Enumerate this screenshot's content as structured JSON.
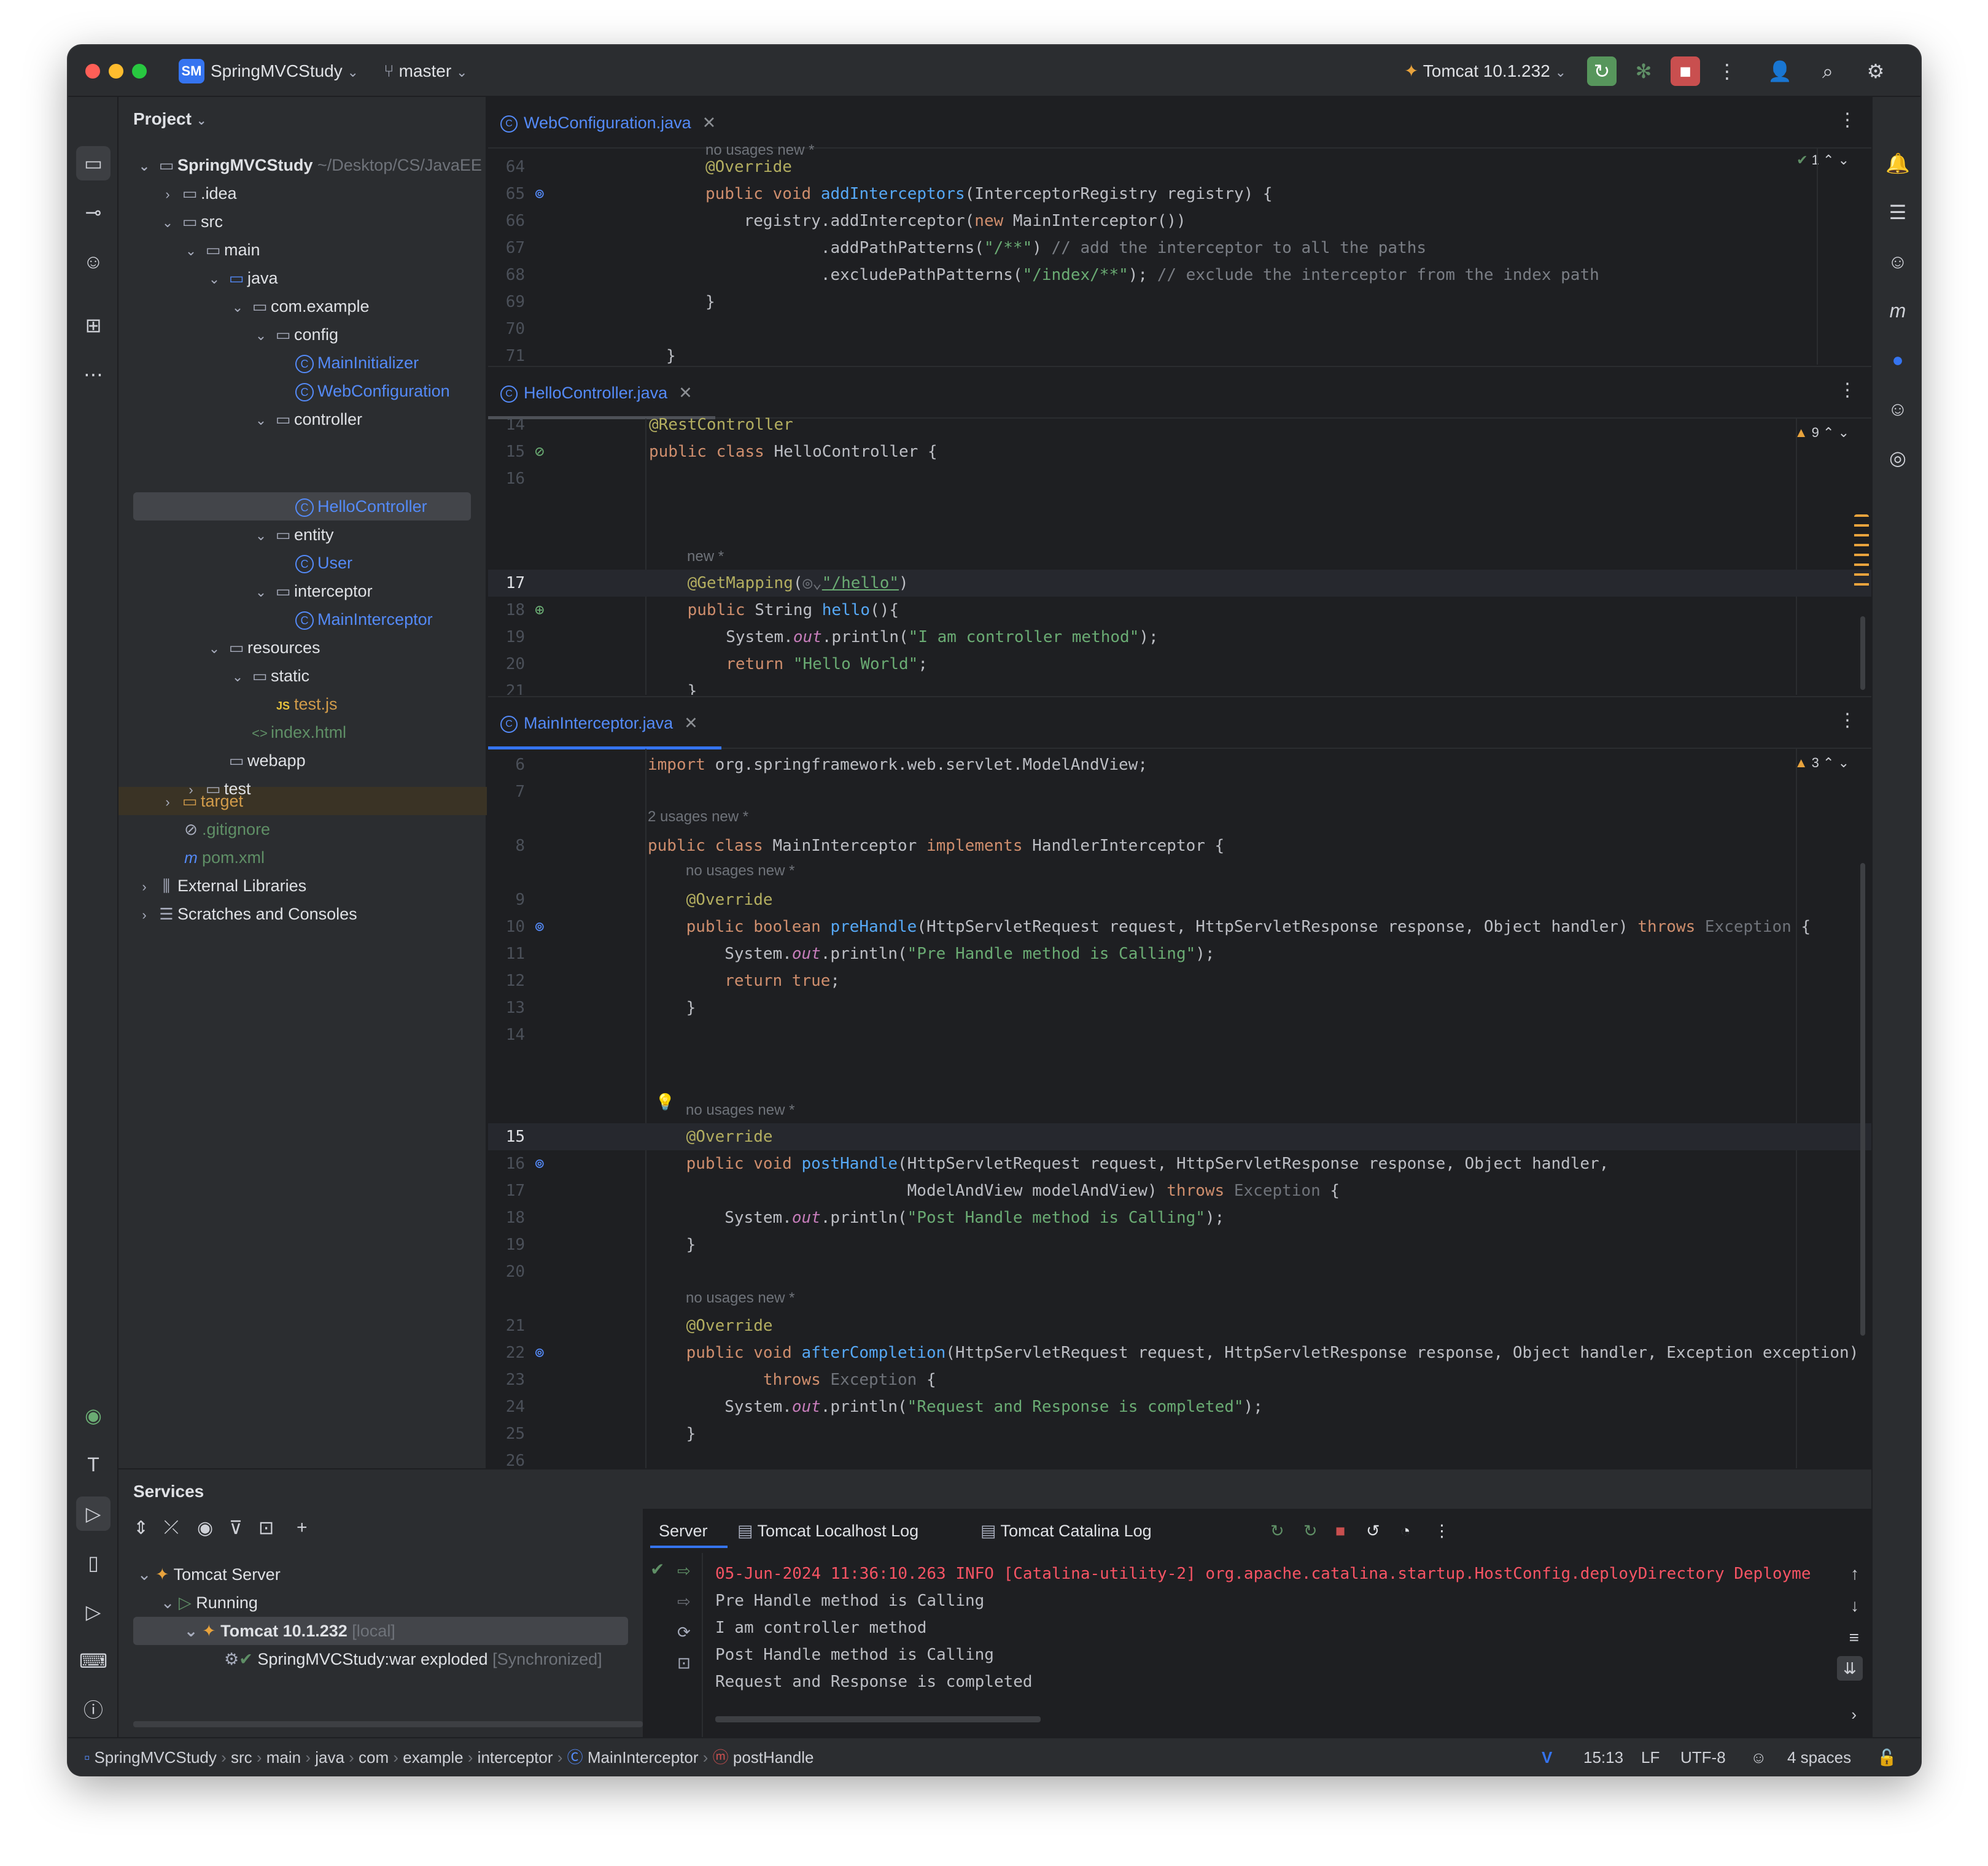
{
  "titlebar": {
    "project_badge": "SM",
    "project_name": "SpringMVCStudy",
    "branch": "master",
    "run_config": "Tomcat 10.1.232"
  },
  "project_panel": {
    "title": "Project",
    "tree": [
      {
        "label": "SpringMVCStudy",
        "path": "~/Desktop/CS/JavaEE"
      },
      {
        "label": ".idea"
      },
      {
        "label": "src"
      },
      {
        "label": "main"
      },
      {
        "label": "java"
      },
      {
        "label": "com.example"
      },
      {
        "label": "config"
      },
      {
        "label": "MainInitializer"
      },
      {
        "label": "WebConfiguration"
      },
      {
        "label": "controller"
      },
      {
        "label": "HelloController"
      },
      {
        "label": "entity"
      },
      {
        "label": "User"
      },
      {
        "label": "interceptor"
      },
      {
        "label": "MainInterceptor"
      },
      {
        "label": "resources"
      },
      {
        "label": "static"
      },
      {
        "label": "test.js"
      },
      {
        "label": "index.html"
      },
      {
        "label": "webapp"
      },
      {
        "label": "test"
      },
      {
        "label": "target"
      },
      {
        "label": ".gitignore"
      },
      {
        "label": "pom.xml"
      },
      {
        "label": "External Libraries"
      },
      {
        "label": "Scratches and Consoles"
      }
    ]
  },
  "editor1": {
    "tab": "WebConfiguration.java",
    "hint_top": "no usages   new *",
    "inspect": "1",
    "lines": [
      {
        "n": "64",
        "t": "@Override"
      },
      {
        "n": "65",
        "t": "public void addInterceptors(InterceptorRegistry registry) {"
      },
      {
        "n": "66",
        "t": "    registry.addInterceptor(new MainInterceptor())"
      },
      {
        "n": "67",
        "t": "            .addPathPatterns(\"/**\") // add the interceptor to all the paths"
      },
      {
        "n": "68",
        "t": "            .excludePathPatterns(\"/index/**\"); // exclude the interceptor from the index path"
      },
      {
        "n": "69",
        "t": "}"
      },
      {
        "n": "70",
        "t": ""
      },
      {
        "n": "71",
        "t": "}"
      }
    ]
  },
  "editor2": {
    "tab": "HelloController.java",
    "inspect": "9",
    "hint_new": "new *",
    "lines": [
      {
        "n": "14",
        "t": "@RestController"
      },
      {
        "n": "15",
        "t": "public class HelloController {"
      },
      {
        "n": "16",
        "t": ""
      },
      {
        "n": "17",
        "t": "    @GetMapping(\"/hello\")"
      },
      {
        "n": "18",
        "t": "    public String hello(){"
      },
      {
        "n": "19",
        "t": "        System.out.println(\"I am controller method\");"
      },
      {
        "n": "20",
        "t": "        return \"Hello World\";"
      },
      {
        "n": "21",
        "t": "    }"
      },
      {
        "n": "22",
        "t": ""
      }
    ]
  },
  "editor3": {
    "tab": "MainInterceptor.java",
    "inspect": "3",
    "hint_class": "2 usages   new *",
    "hint_method": "no usages   new *",
    "lines": [
      {
        "n": "6",
        "t": "import org.springframework.web.servlet.ModelAndView;"
      },
      {
        "n": "7",
        "t": ""
      },
      {
        "n": "8",
        "t": "public class MainInterceptor implements HandlerInterceptor {"
      },
      {
        "n": "9",
        "t": "    @Override"
      },
      {
        "n": "10",
        "t": "    public boolean preHandle(HttpServletRequest request, HttpServletResponse response, Object handler) throws Exception {"
      },
      {
        "n": "11",
        "t": "        System.out.println(\"Pre Handle method is Calling\");"
      },
      {
        "n": "12",
        "t": "        return true;"
      },
      {
        "n": "13",
        "t": "    }"
      },
      {
        "n": "14",
        "t": ""
      },
      {
        "n": "15",
        "t": "    @Override"
      },
      {
        "n": "16",
        "t": "    public void postHandle(HttpServletRequest request, HttpServletResponse response, Object handler,"
      },
      {
        "n": "17",
        "t": "                           ModelAndView modelAndView) throws Exception {"
      },
      {
        "n": "18",
        "t": "        System.out.println(\"Post Handle method is Calling\");"
      },
      {
        "n": "19",
        "t": "    }"
      },
      {
        "n": "20",
        "t": ""
      },
      {
        "n": "21",
        "t": "    @Override"
      },
      {
        "n": "22",
        "t": "    public void afterCompletion(HttpServletRequest request, HttpServletResponse response, Object handler, Exception exception)"
      },
      {
        "n": "23",
        "t": "            throws Exception {"
      },
      {
        "n": "24",
        "t": "        System.out.println(\"Request and Response is completed\");"
      },
      {
        "n": "25",
        "t": "    }"
      },
      {
        "n": "26",
        "t": ""
      },
      {
        "n": "27",
        "t": "}"
      }
    ]
  },
  "services": {
    "title": "Services",
    "tree": [
      {
        "label": "Tomcat Server"
      },
      {
        "label": "Running"
      },
      {
        "label": "Tomcat 10.1.232",
        "suffix": "[local]"
      },
      {
        "label": "SpringMVCStudy:war exploded",
        "suffix": "[Synchronized]"
      }
    ],
    "console_tabs": [
      "Server",
      "Tomcat Localhost Log",
      "Tomcat Catalina Log"
    ],
    "log_lines": [
      "05-Jun-2024 11:36:10.263 INFO [Catalina-utility-2] org.apache.catalina.startup.HostConfig.deployDirectory Deployme",
      "Pre Handle method is Calling",
      "I am controller method",
      "Post Handle method is Calling",
      "Request and Response is completed"
    ]
  },
  "statusbar": {
    "breadcrumbs": [
      "SpringMVCStudy",
      "src",
      "main",
      "java",
      "com",
      "example",
      "interceptor",
      "MainInterceptor",
      "postHandle"
    ],
    "cursor": "15:13",
    "line_sep": "LF",
    "encoding": "UTF-8",
    "indent": "4 spaces"
  }
}
